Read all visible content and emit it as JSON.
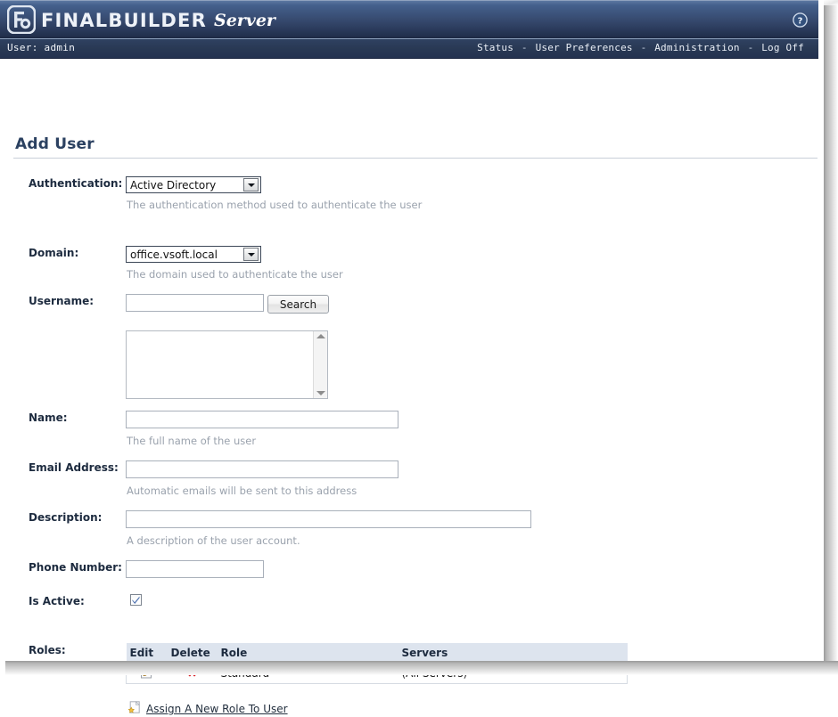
{
  "header": {
    "brand_primary": "FINALBUILDER",
    "brand_secondary": "Server",
    "logo_icon": "finalbuilder-logo-icon",
    "help_icon": "help-question-icon"
  },
  "navbar": {
    "user_label": "User: admin",
    "links": [
      {
        "label": "Status"
      },
      {
        "label": "User Preferences"
      },
      {
        "label": "Administration"
      },
      {
        "label": "Log Off"
      }
    ],
    "separator": "-"
  },
  "page": {
    "title": "Add User"
  },
  "form": {
    "authentication": {
      "label": "Authentication:",
      "value": "Active Directory",
      "hint": "The authentication method used to authenticate the user"
    },
    "domain": {
      "label": "Domain:",
      "value": "office.vsoft.local",
      "hint": "The domain used to authenticate the user"
    },
    "username": {
      "label": "Username:",
      "value": "",
      "search_button": "Search"
    },
    "results": {
      "value": ""
    },
    "name": {
      "label": "Name:",
      "value": "",
      "hint": "The full name of the user"
    },
    "email": {
      "label": "Email Address:",
      "value": "",
      "hint": "Automatic emails will be sent to this address"
    },
    "description": {
      "label": "Description:",
      "value": "",
      "hint": "A description of the user account."
    },
    "phone": {
      "label": "Phone Number:",
      "value": ""
    },
    "is_active": {
      "label": "Is Active:",
      "checked": true
    },
    "roles": {
      "label": "Roles:",
      "columns": [
        "Edit",
        "Delete",
        "Role",
        "Servers"
      ],
      "rows": [
        {
          "edit_icon": "edit-pencil-icon",
          "delete_icon": "delete-x-icon",
          "delete_glyph": "✖",
          "role": "Standard",
          "servers": "(All Servers)"
        }
      ],
      "assign_link": {
        "icon": "new-page-star-icon",
        "label": "Assign A New Role To User"
      }
    }
  },
  "colors": {
    "header_top": "#5b76a0",
    "header_bottom": "#22304d",
    "navbar": "#293954",
    "title": "#2b4161",
    "table_header": "#dde4ee",
    "delete_red": "#d81f26",
    "star_yellow": "#f5c141",
    "hint_gray": "#9aa2ad"
  }
}
